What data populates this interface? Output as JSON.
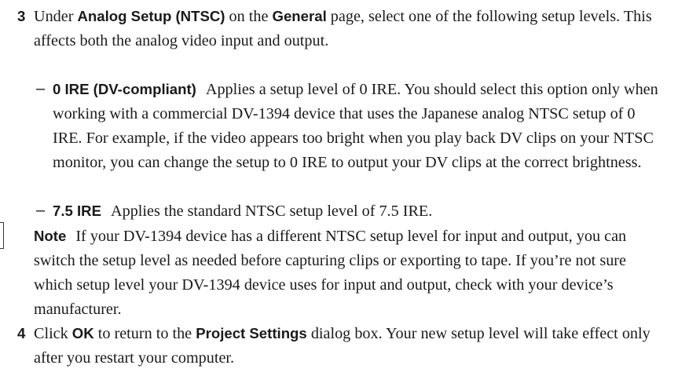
{
  "step3": {
    "number": "3",
    "text_1": "Under ",
    "bold_1": "Analog Setup (NTSC)",
    "text_2": " on the ",
    "bold_2": "General",
    "text_3": " page, select one of the following setup levels. This affects both the analog video input and output."
  },
  "options": [
    {
      "bullet": "–",
      "label": "0 IRE (DV-compliant)",
      "description": "Applies a setup level of 0 IRE. You should select this option only when working with a commercial DV-1394 device that uses the Japanese analog NTSC setup of 0 IRE. For example, if the video appears too bright when you play back DV clips on your NTSC monitor, you can change the setup to 0 IRE to output your DV clips at the correct brightness."
    },
    {
      "bullet": "–",
      "label": "7.5 IRE",
      "description": "Applies the standard NTSC setup level of 7.5 IRE."
    }
  ],
  "note": {
    "label": "Note",
    "text": "If your DV-1394 device has a different NTSC setup level for input and output, you can switch the setup level as needed before capturing clips or exporting to tape. If you’re not sure which setup level your DV-1394 device uses for input and output, check with your device’s manufacturer."
  },
  "step4": {
    "number": "4",
    "text_1": "Click ",
    "bold_1": "OK",
    "text_2": " to return to the ",
    "bold_2": "Project Settings",
    "text_3": " dialog box. Your new setup level will take effect only after you restart your computer."
  }
}
